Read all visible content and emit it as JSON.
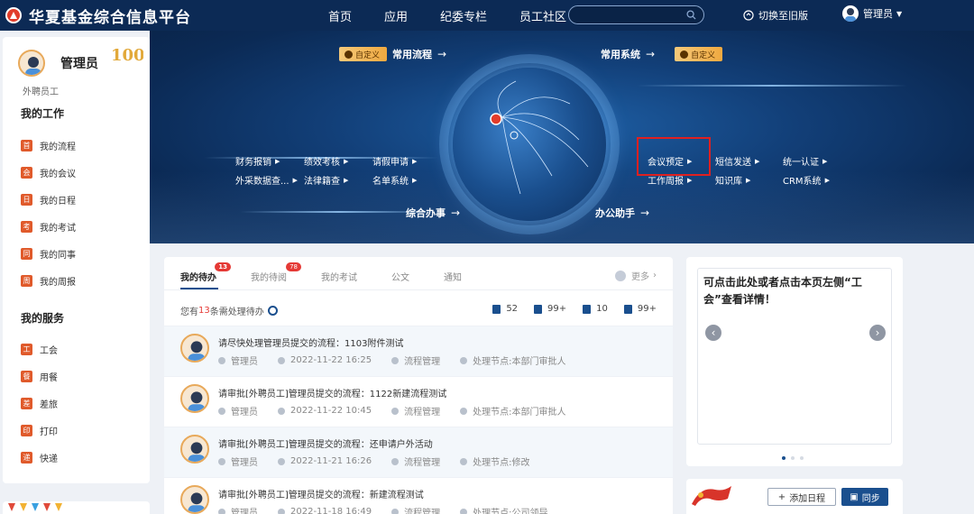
{
  "header": {
    "logo_text": "华夏基金综合信息平台",
    "nav": [
      "首页",
      "应用",
      "纪委专栏",
      "员工社区"
    ],
    "search_placeholder": "",
    "switch_old": "切换至旧版",
    "user": "管理员"
  },
  "banner": {
    "custom_label": "自定义",
    "common_flow": "常用流程",
    "common_system": "常用系统",
    "comprehensive": "综合办事",
    "office_assistant": "办公助手",
    "left_links_row1": [
      "财务报销",
      "绩效考核",
      "请假申请"
    ],
    "left_links_row2": [
      "外采数据查...",
      "法律籍查",
      "名单系统"
    ],
    "right_links_row1": [
      "会议预定",
      "短信发送",
      "统一认证"
    ],
    "right_links_row2": [
      "工作周报",
      "知识库",
      "CRM系统"
    ]
  },
  "sidebar": {
    "name": "管理员",
    "role": "外聘员工",
    "my_work_title": "我的工作",
    "my_work": [
      {
        "icon": "首",
        "label": "我的流程"
      },
      {
        "icon": "会",
        "label": "我的会议"
      },
      {
        "icon": "日",
        "label": "我的日程"
      },
      {
        "icon": "考",
        "label": "我的考试"
      },
      {
        "icon": "同",
        "label": "我的同事"
      },
      {
        "icon": "周",
        "label": "我的周报"
      }
    ],
    "my_service_title": "我的服务",
    "my_service": [
      {
        "icon": "工",
        "label": "工会"
      },
      {
        "icon": "餐",
        "label": "用餐"
      },
      {
        "icon": "差",
        "label": "差旅"
      },
      {
        "icon": "印",
        "label": "打印"
      },
      {
        "icon": "递",
        "label": "快递"
      }
    ]
  },
  "todo": {
    "tabs": [
      {
        "label": "我的待办",
        "badge": "13"
      },
      {
        "label": "我的待阅",
        "badge": "78"
      },
      {
        "label": "我的考试",
        "badge": ""
      },
      {
        "label": "公文",
        "badge": ""
      },
      {
        "label": "通知",
        "badge": ""
      }
    ],
    "more": "更多",
    "pending_prefix": "您有",
    "pending_count": "13",
    "pending_suffix": "条需处理待办",
    "stats": [
      "52",
      "99+",
      "10",
      "99+"
    ],
    "rows": [
      {
        "title": "请尽快处理管理员提交的流程：1103附件测试",
        "user": "管理员",
        "time": "2022-11-22 16:25",
        "type": "流程管理",
        "node": "处理节点:本部门审批人"
      },
      {
        "title": "请审批[外聘员工]管理员提交的流程：1122新建流程测试",
        "user": "管理员",
        "time": "2022-11-22 10:45",
        "type": "流程管理",
        "node": "处理节点:本部门审批人"
      },
      {
        "title": "请审批[外聘员工]管理员提交的流程：还申请户外活动",
        "user": "管理员",
        "time": "2022-11-21 16:26",
        "type": "流程管理",
        "node": "处理节点:修改"
      },
      {
        "title": "请审批[外聘员工]管理员提交的流程：新建流程测试",
        "user": "管理员",
        "time": "2022-11-18 16:49",
        "type": "流程管理",
        "node": "处理节点:公司领导"
      }
    ]
  },
  "notice": {
    "text": "可点击此处或者点击本页左侧“工会”查看详情！"
  },
  "schedule": {
    "add": "添加日程",
    "sync": "同步"
  }
}
